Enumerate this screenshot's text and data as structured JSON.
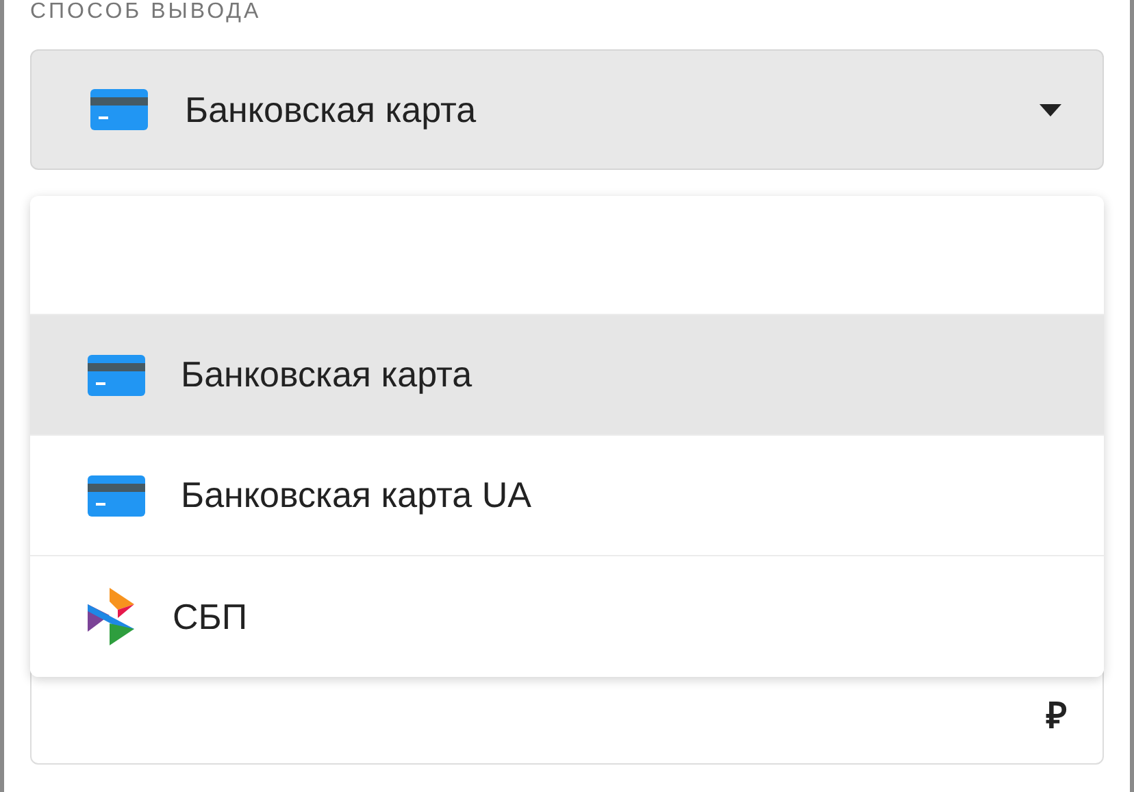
{
  "label": "СПОСОБ ВЫВОДА",
  "select": {
    "value": "Банковская карта",
    "kind": "card",
    "expanded": true
  },
  "options": [
    {
      "label": "Банковская карта",
      "kind": "card",
      "selected": true
    },
    {
      "label": "Банковская карта UA",
      "kind": "card",
      "selected": false
    },
    {
      "label": "СБП",
      "kind": "sbp",
      "selected": false
    }
  ],
  "amount_field": {
    "currency": "₽"
  }
}
